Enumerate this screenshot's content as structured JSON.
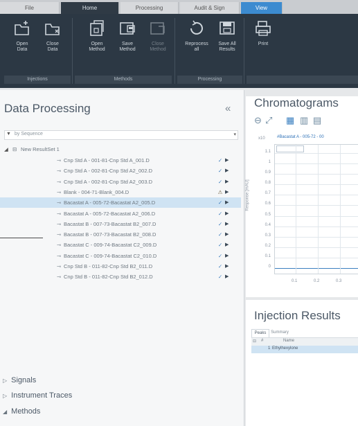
{
  "tabs": [
    {
      "label": "File"
    },
    {
      "label": "Home"
    },
    {
      "label": "Processing"
    },
    {
      "label": "Audit & Sign"
    },
    {
      "label": "View"
    }
  ],
  "ribbon": {
    "buttons": [
      {
        "label1": "Open",
        "label2": "Data"
      },
      {
        "label1": "Close",
        "label2": "Data"
      },
      {
        "label1": "Open",
        "label2": "Method"
      },
      {
        "label1": "Save",
        "label2": "Method"
      },
      {
        "label1": "Close",
        "label2": "Method"
      },
      {
        "label1": "Reprocess",
        "label2": "all"
      },
      {
        "label1": "Save All",
        "label2": "Results"
      },
      {
        "label1": "Print",
        "label2": ""
      }
    ],
    "groups": [
      "Injections",
      "Methods",
      "Processing"
    ]
  },
  "data_processing": {
    "title": "Data Processing",
    "collapse_glyph": "«",
    "filter_placeholder": "by Sequence",
    "result_set": "New ResultSet 1",
    "items": [
      {
        "label": "Cnp Std A - 001-81-Cnp Std A_001.D",
        "status": "✓"
      },
      {
        "label": "Cnp Std A - 002-81-Cnp Std A2_002.D",
        "status": "✓"
      },
      {
        "label": "Cnp Std A - 002-81-Cnp Std A2_003.D",
        "status": "✓"
      },
      {
        "label": "Blank - 004-71-Blank_004.D",
        "status": "⚠"
      },
      {
        "label": "Bacastat A - 005-72-Bacastat A2_005.D",
        "status": "✓"
      },
      {
        "label": "Bacastat A - 005-72-Bacastat A2_006.D",
        "status": "✓"
      },
      {
        "label": "Bacastat B - 007-73-Bacastat B2_007.D",
        "status": "✓"
      },
      {
        "label": "Bacastat B - 007-73-Bacastat B2_008.D",
        "status": "✓"
      },
      {
        "label": "Bacastat C - 009-74-Bacastat C2_009.D",
        "status": "✓"
      },
      {
        "label": "Bacastat C - 009-74-Bacastat C2_010.D",
        "status": "✓"
      },
      {
        "label": "Cnp Std B - 011-82-Cnp Std B2_011.D",
        "status": "✓"
      },
      {
        "label": "Cnp Std B - 011-82-Cnp Std B2_012.D",
        "status": "✓"
      }
    ],
    "sections": [
      "Signals",
      "Instrument Traces",
      "Methods"
    ]
  },
  "chromatograms": {
    "title": "Chromatograms",
    "legend": "#Bacastat A - 005-72 - 00",
    "y_multiplier": "x10",
    "y_units_label": "Response [mAU]",
    "y_ticks": [
      "1.1",
      "1",
      "0.9",
      "0.8",
      "0.7",
      "0.6",
      "0.5",
      "0.4",
      "0.3",
      "0.2",
      "0.1",
      "0"
    ],
    "x_ticks": [
      "0.1",
      "0.2",
      "0.3"
    ]
  },
  "injection_results": {
    "title": "Injection Results",
    "tabs": [
      "Peaks",
      "Summary"
    ],
    "columns": [
      "#",
      "Name"
    ],
    "rows": [
      {
        "num": "1",
        "name": "Ethylhexylone"
      }
    ]
  }
}
